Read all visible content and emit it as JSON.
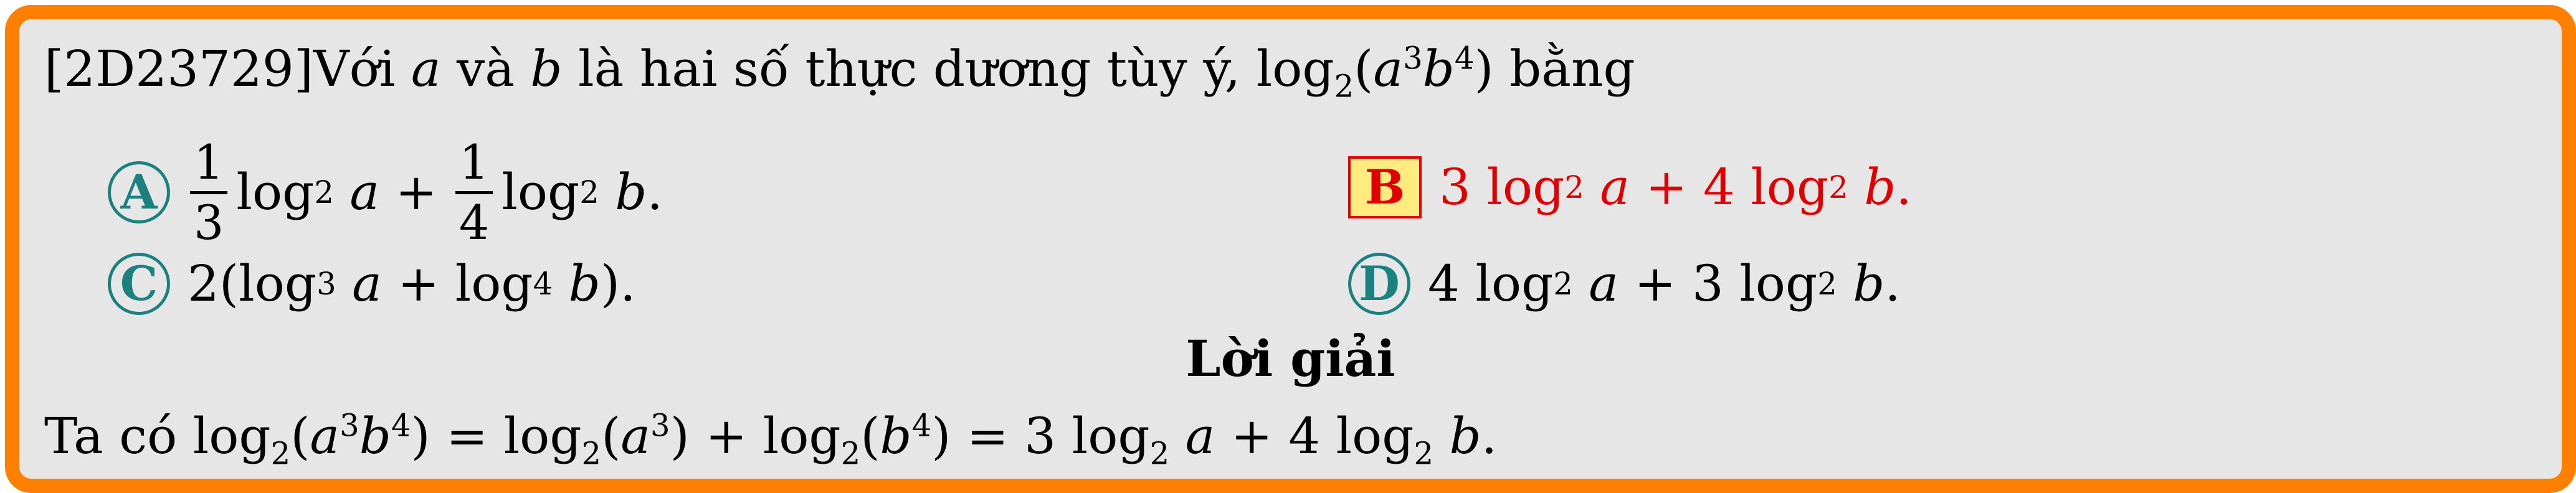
{
  "question": {
    "code": "[2D23729]",
    "stem_text_1": "Với ",
    "var_a": "a",
    "stem_text_2": " và ",
    "var_b": "b",
    "stem_text_3": " là hai số thực dương tùy ý, ",
    "stem_expr": "log₂(a³b⁴)",
    "stem_text_4": " bằng"
  },
  "options": [
    {
      "letter": "A",
      "expr": "1/3 log₂ a + 1/4 log₂ b.",
      "correct": false
    },
    {
      "letter": "B",
      "expr": "3 log₂ a + 4 log₂ b.",
      "correct": true
    },
    {
      "letter": "C",
      "expr": "2(log₃ a + log₄ b).",
      "correct": false
    },
    {
      "letter": "D",
      "expr": "4 log₂ a + 3 log₂ b.",
      "correct": false
    }
  ],
  "solution": {
    "title": "Lời giải",
    "lead": "Ta có ",
    "expr": "log₂(a³b⁴) = log₂(a³) + log₂(b⁴) = 3 log₂ a + 4 log₂ b."
  },
  "colors": {
    "frame": "#ff8000",
    "background": "#e6e6e6",
    "badge": "#1a8080",
    "correct": "#e00000",
    "correct_badge_fill": "#ffeb80"
  }
}
